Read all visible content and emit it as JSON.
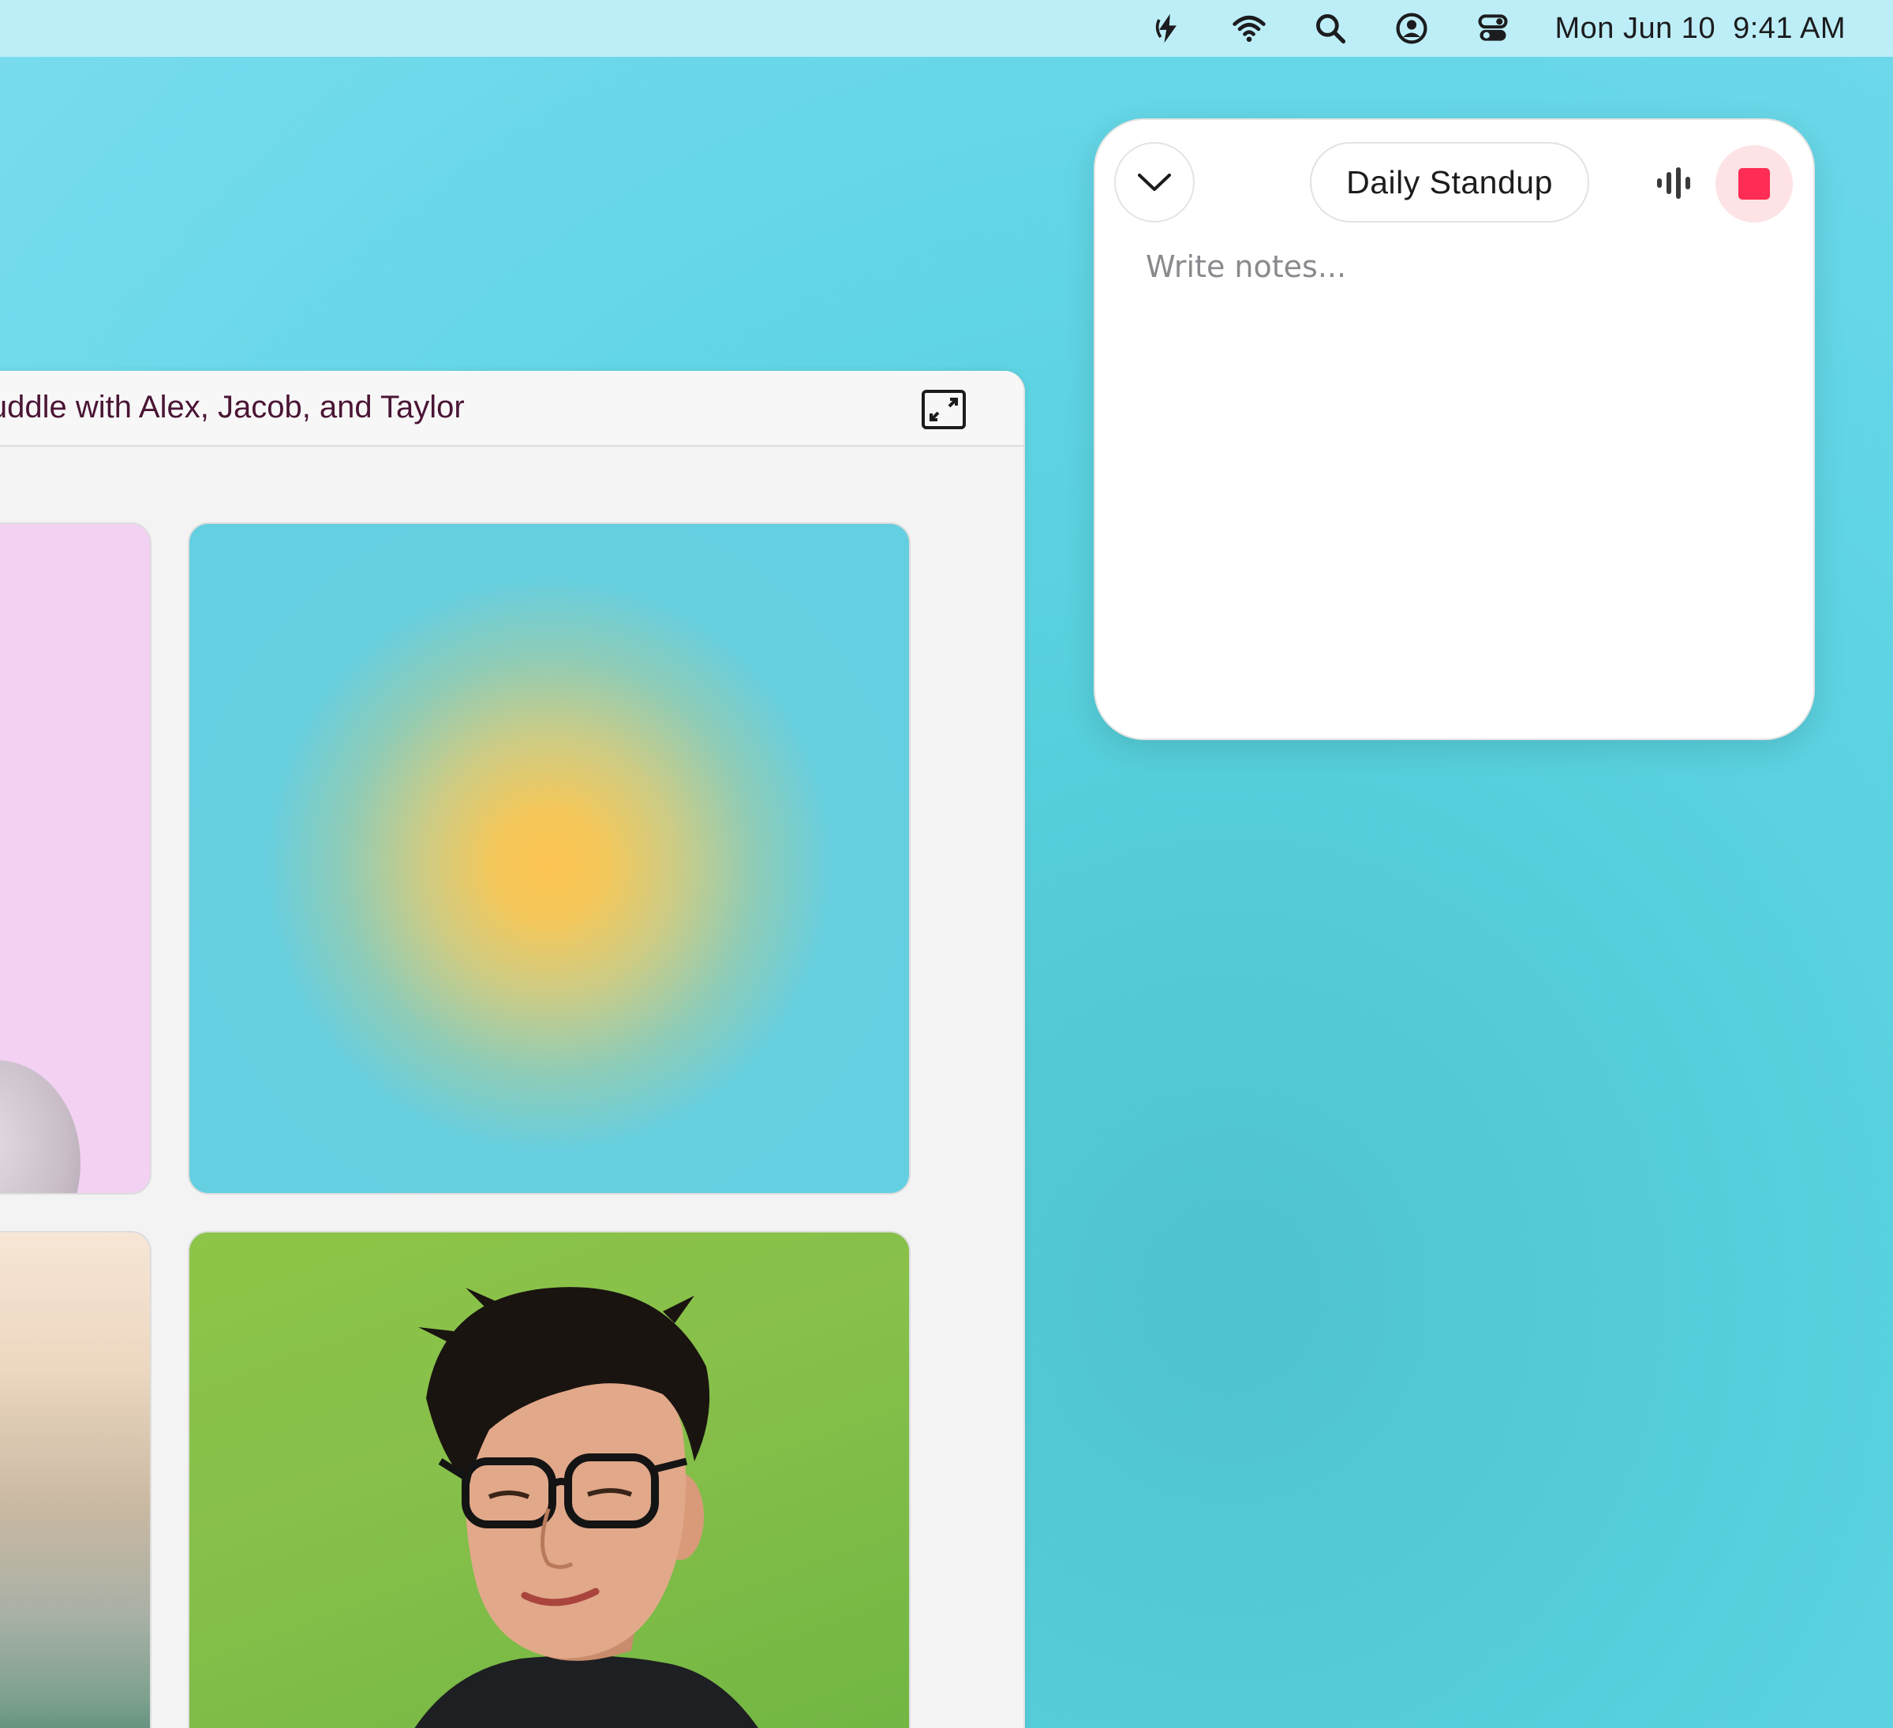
{
  "menubar": {
    "icons": [
      "bolt-icon",
      "wifi-icon",
      "search-icon",
      "user-account-icon",
      "control-center-icon"
    ],
    "date": "Mon Jun 10",
    "time": "9:41 AM"
  },
  "huddle": {
    "title": "Huddle with Alex, Jacob, and Taylor",
    "expand_icon": "expand-window-icon"
  },
  "notes": {
    "meeting_title": "Daily Standup",
    "placeholder": "Write notes...",
    "collapse_icon": "chevron-down-icon",
    "audio_icon": "audio-waveform-icon",
    "stop_icon": "stop-icon",
    "stop_color": "#ff2d55"
  },
  "colors": {
    "huddle_title": "#4a1535",
    "background": "#62d6e6",
    "menubar": "#bdeef8"
  }
}
